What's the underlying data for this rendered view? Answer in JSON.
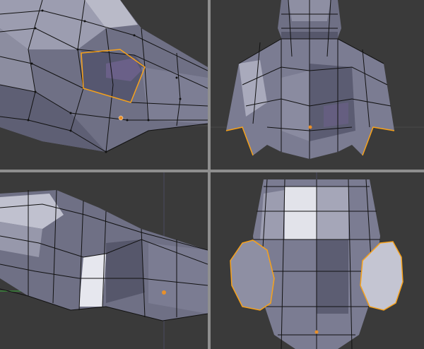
{
  "app": {
    "description_hidden": "",
    "accent_color": "#f7a21b",
    "mesh_color": "#7a7b8e",
    "mesh_light_color": "#c9cad6",
    "mesh_dark_color": "#555668",
    "wire_color": "#111111",
    "background_color": "#393939",
    "divider_color": "#8e8e8e",
    "origin_color": "#e8902a"
  },
  "viewports": [
    {
      "id": "top-left"
    },
    {
      "id": "top-right"
    },
    {
      "id": "bottom-left"
    },
    {
      "id": "bottom-right"
    }
  ]
}
